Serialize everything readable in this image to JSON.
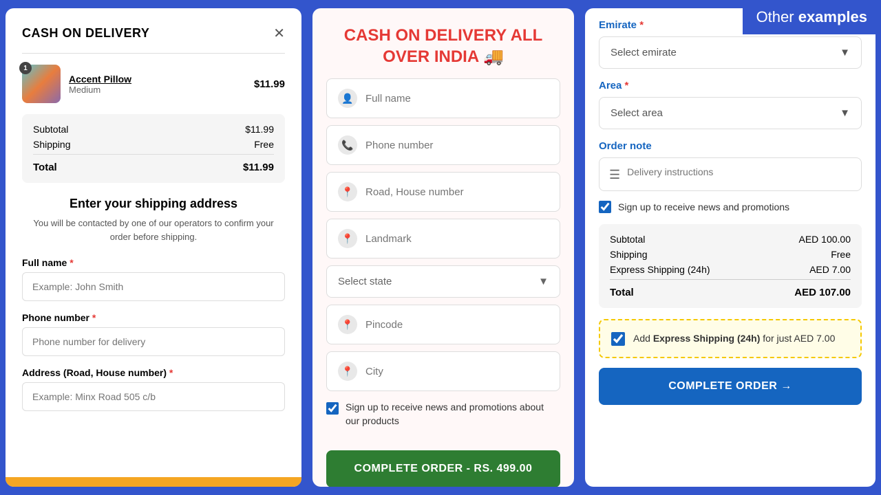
{
  "badge": {
    "other": "Other ",
    "examples": "examples"
  },
  "left": {
    "title": "CASH ON DELIVERY",
    "product": {
      "name": "Accent Pillow",
      "variant": "Medium",
      "price": "$11.99",
      "badge": "1"
    },
    "summary": {
      "subtotal_label": "Subtotal",
      "subtotal_value": "$11.99",
      "shipping_label": "Shipping",
      "shipping_value": "Free",
      "total_label": "Total",
      "total_value": "$11.99"
    },
    "shipping": {
      "title": "Enter your shipping address",
      "desc": "You will be contacted by one of our operators to confirm your order before shipping.",
      "full_name_label": "Full name",
      "full_name_placeholder": "Example: John Smith",
      "phone_label": "Phone number",
      "phone_placeholder": "Phone number for delivery",
      "address_label": "Address (Road, House number)",
      "address_placeholder": "Example: Minx Road 505 c/b"
    }
  },
  "middle": {
    "title": "CASH ON DELIVERY ALL OVER INDIA 🚚",
    "fields": {
      "full_name": "Full name",
      "phone": "Phone number",
      "road": "Road, House number",
      "landmark": "Landmark",
      "select_state": "Select state",
      "pincode": "Pincode",
      "city": "City"
    },
    "checkbox_label": "Sign up to receive news and promotions about our products",
    "complete_btn": "COMPLETE ORDER - Rs. 499.00"
  },
  "right": {
    "emirate_label": "Emirate",
    "emirate_required": "*",
    "emirate_placeholder": "Select emirate",
    "area_label": "Area",
    "area_required": "*",
    "area_placeholder": "Select area",
    "order_note_label": "Order note",
    "delivery_placeholder": "Delivery instructions",
    "signup_label": "Sign up to receive news and promotions",
    "summary": {
      "subtotal_label": "Subtotal",
      "subtotal_value": "AED 100.00",
      "shipping_label": "Shipping",
      "shipping_value": "Free",
      "express_label": "Express Shipping (24h)",
      "express_value": "AED 7.00",
      "total_label": "Total",
      "total_value": "AED 107.00"
    },
    "express_banner": {
      "prefix": "Add ",
      "bold": "Express Shipping (24h)",
      "suffix": " for just AED 7.00"
    },
    "complete_btn": "COMPLETE ORDER →"
  }
}
